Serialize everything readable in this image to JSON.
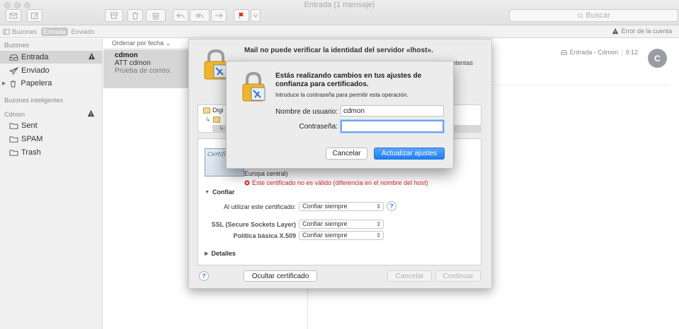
{
  "window": {
    "title": "Entrada (1 mensaje)"
  },
  "toolbar": {
    "search_placeholder": "Buscar"
  },
  "favorites": {
    "buzones": "Buzones",
    "entrada": "Entrada",
    "enviado": "Enviado",
    "account_error": "Error de la cuenta"
  },
  "sidebar": {
    "section_mailboxes": "Buzones",
    "items": [
      {
        "label": "Entrada"
      },
      {
        "label": "Enviado"
      },
      {
        "label": "Papelera"
      }
    ],
    "section_smart": "Buzones inteligentes",
    "account": "Cdmon",
    "account_items": [
      {
        "label": "Sent"
      },
      {
        "label": "SPAM"
      },
      {
        "label": "Trash"
      }
    ]
  },
  "message_list": {
    "sort_label": "Ordenar por fecha",
    "messages": [
      {
        "from": "cdmon",
        "subject": "ATT cdmon",
        "preview": "Prueba de correo."
      }
    ]
  },
  "preview": {
    "mailbox": "Entrada - Cdmon",
    "time": "9:12",
    "avatar_initial": "C"
  },
  "cert_sheet": {
    "title": "Mail no puede verificar la identidad del servidor «lhost».",
    "title_right": "ntentas",
    "tree_item_1": "Digi",
    "detail_line": "Europa central)",
    "error": "Este certificado no es válido (diferencia en el nombre del host)",
    "trust_label": "Confiar",
    "when_using_label": "Al utilizar este certificado:",
    "when_using_value": "Confiar siempre",
    "ssl_label": "SSL (Secure Sockets Layer)",
    "ssl_value": "Confiar siempre",
    "x509_label": "Política básica X.509",
    "x509_value": "Confiar siempre",
    "details_label": "Detalles",
    "hide_cert_button": "Ocultar certificado",
    "cancel_button": "Cancelar",
    "continue_button": "Continuar",
    "cert_thumb_text": "Certific"
  },
  "auth_dialog": {
    "title": "Estás realizando cambios en tus ajustes de confianza para certificados.",
    "subtitle": "Introduce la contraseña para permitir esta operación.",
    "username_label": "Nombre de usuario:",
    "username_value": "cdmon",
    "password_label": "Contraseña:",
    "password_value": "",
    "cancel_button": "Cancelar",
    "update_button": "Actualizar ajustes"
  },
  "colors": {
    "accent": "#1f7ef3",
    "error": "#d42a2a",
    "flag": "#e0342c"
  }
}
